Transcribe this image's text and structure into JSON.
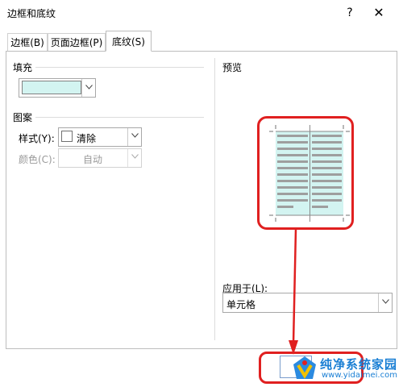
{
  "dialog": {
    "title": "边框和底纹",
    "help_label": "?",
    "close_label": "✕"
  },
  "tabs": [
    {
      "label": "边框(B)"
    },
    {
      "label": "页面边框(P)"
    },
    {
      "label": "底纹(S)",
      "active": true
    }
  ],
  "fill": {
    "group_label": "填充",
    "selected_color": "#d3f4f1"
  },
  "pattern": {
    "group_label": "图案",
    "style_label": "样式(Y):",
    "style_value": "清除",
    "color_label": "颜色(C):",
    "color_value": "自动"
  },
  "preview": {
    "label": "预览",
    "shading_color": "#d3f4f1"
  },
  "apply_to": {
    "label": "应用于(L):",
    "value": "单元格"
  },
  "watermark": {
    "text": "纯净系统家园",
    "url": "www.yidaimei.com"
  },
  "colors": {
    "annotation_red": "#e02020",
    "watermark_blue": "#1a7fd4"
  }
}
